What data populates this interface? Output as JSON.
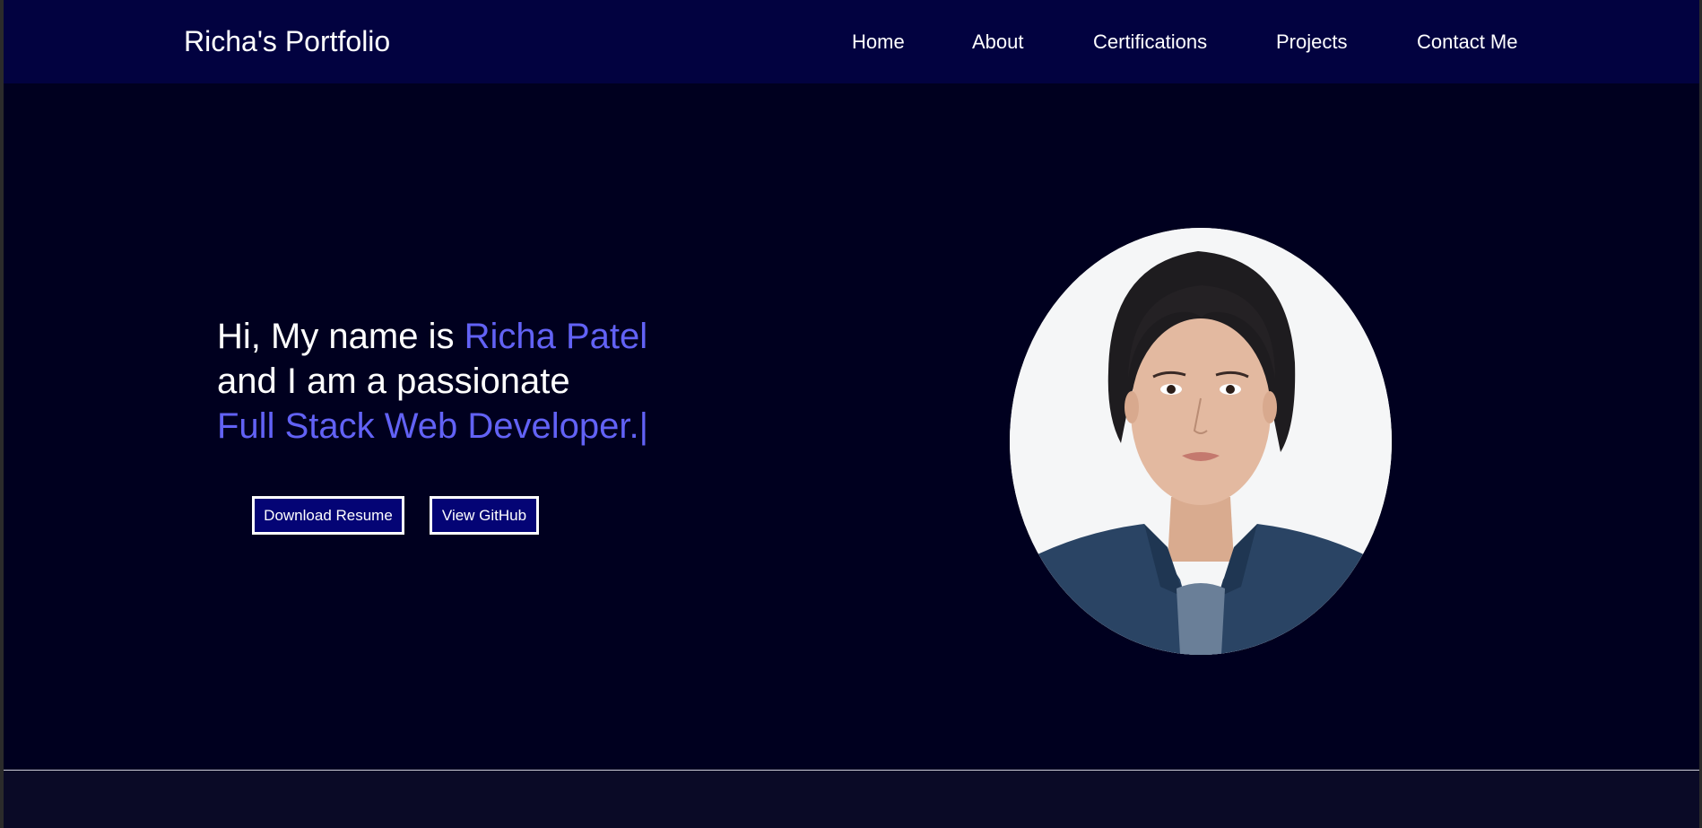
{
  "nav": {
    "brand": "Richa's Portfolio",
    "links": [
      "Home",
      "About",
      "Certifications",
      "Projects",
      "Contact Me"
    ]
  },
  "hero": {
    "line1_prefix": "Hi, My name is ",
    "line1_name": "Richa Patel",
    "line2": "and I am a passionate",
    "line3": "Full Stack Web Developer.",
    "cursor": "|",
    "buttons": {
      "resume": "Download Resume",
      "github": "View GitHub"
    }
  },
  "colors": {
    "page_bg": "#00001f",
    "navbar_bg": "#020240",
    "accent": "#6262f5",
    "button_bg": "#040475",
    "footer_bg": "#0a0a26"
  },
  "icons": {
    "portrait": "profile-photo"
  }
}
